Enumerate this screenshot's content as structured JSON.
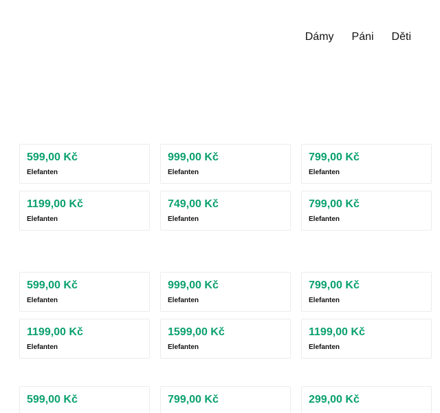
{
  "nav": {
    "items": [
      {
        "label": "Dámy"
      },
      {
        "label": "Páni"
      },
      {
        "label": "Děti"
      }
    ]
  },
  "sections": [
    {
      "products": [
        {
          "price": "599,00 Kč",
          "brand": "Elefanten"
        },
        {
          "price": "999,00 Kč",
          "brand": "Elefanten"
        },
        {
          "price": "799,00 Kč",
          "brand": "Elefanten"
        },
        {
          "price": "1199,00 Kč",
          "brand": "Elefanten"
        },
        {
          "price": "749,00 Kč",
          "brand": "Elefanten"
        },
        {
          "price": "799,00 Kč",
          "brand": "Elefanten"
        }
      ]
    },
    {
      "products": [
        {
          "price": "599,00 Kč",
          "brand": "Elefanten"
        },
        {
          "price": "999,00 Kč",
          "brand": "Elefanten"
        },
        {
          "price": "799,00 Kč",
          "brand": "Elefanten"
        },
        {
          "price": "1199,00 Kč",
          "brand": "Elefanten"
        },
        {
          "price": "1599,00 Kč",
          "brand": "Elefanten"
        },
        {
          "price": "1199,00 Kč",
          "brand": "Elefanten"
        }
      ]
    },
    {
      "products": [
        {
          "price": "599,00 Kč",
          "brand": ""
        },
        {
          "price": "799,00 Kč",
          "brand": ""
        },
        {
          "price": "299,00 Kč",
          "brand": ""
        }
      ]
    }
  ]
}
